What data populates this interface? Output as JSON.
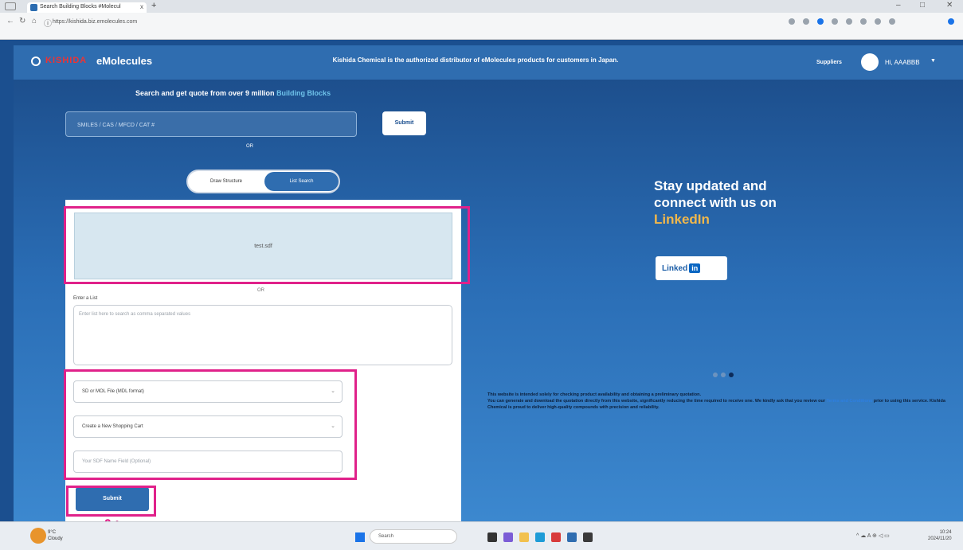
{
  "browser": {
    "tab_title": "Search Building Blocks #Molecul",
    "tab_close": "x",
    "new_tab": "+",
    "url": "https://kishida.biz.emolecules.com",
    "window_controls": [
      "–",
      "□",
      "✕"
    ]
  },
  "header": {
    "brand_kishida": "KISHIDA",
    "brand_emolecules": "eMolecules",
    "message": "Kishida Chemical is the authorized distributor of eMolecules products for customers in Japan.",
    "suppliers_label": "Suppliers",
    "user_label": "Hi, AAABBB",
    "user_caret": "▼"
  },
  "search": {
    "title_prefix": "Search and get quote from over 9 million",
    "title_highlight": "Building Blocks",
    "input_placeholder": "SMILES / CAS / MFCD / CAT #",
    "submit_label": "Submit",
    "or_label": "OR"
  },
  "toggle": {
    "option_a": "Draw Structure",
    "option_b": "List Search",
    "active": "List Search"
  },
  "form": {
    "dropzone_text": "test.sdf",
    "or_label": "OR",
    "list_label": "Enter a List",
    "list_placeholder": "Enter list here to search as comma separated values",
    "select_format": "SD or MOL File (MDL format)",
    "select_cart": "Create a New Shopping Cart",
    "optional_placeholder": "Your SDF Name Field (Optional)",
    "submit_label": "Submit",
    "caret": "⌄"
  },
  "promo": {
    "line1": "Stay updated and",
    "line2": "connect with us on",
    "line3": "LinkedIn",
    "button_text": "Linked",
    "button_in": "in",
    "carousel_active_index": 2
  },
  "disclaimer": {
    "text_1": "This website is intended solely for checking product availability and obtaining a preliminary quotation.",
    "text_2": "You can generate and download the quotation directly from this website, significantly reducing the time required to receive one. We kindly ask that you review our",
    "link": "Terms and Conditions",
    "text_3": "prior to using this service. Kishida Chemical is proud to deliver high-quality compounds with precision and reliability."
  },
  "taskbar": {
    "weather_line1": "9°C",
    "weather_line2": "Cloudy",
    "search_placeholder": "Search",
    "tray_text": "^ ☁ A ⊕ ◁ ▭",
    "clock_line1": "10:24",
    "clock_line2": "2024/11/20"
  },
  "colors": {
    "brand_blue": "#2f6db0",
    "highlight_magenta": "#e0218a",
    "accent_orange": "#f2b84b"
  }
}
